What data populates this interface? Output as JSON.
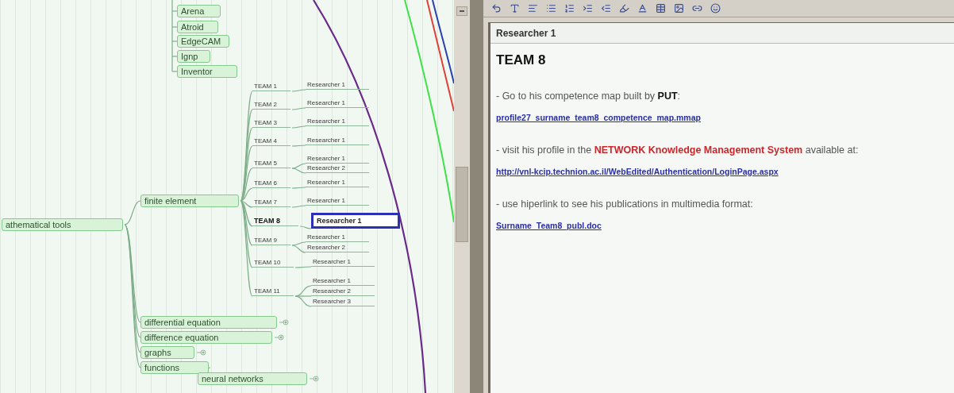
{
  "mind_map": {
    "nodes": [
      {
        "text": "Arena",
        "kind": "bubble",
        "selected": false
      },
      {
        "text": "Atroid",
        "kind": "bubble",
        "selected": false
      },
      {
        "text": "EdgeCAM",
        "kind": "bubble",
        "selected": false
      },
      {
        "text": "Ignp",
        "kind": "bubble",
        "selected": false
      },
      {
        "text": "Inventor",
        "kind": "bubble",
        "selected": false
      },
      {
        "text": "athematical tools",
        "kind": "bubble",
        "selected": false,
        "children": [
          {
            "text": "finite element",
            "kind": "bubble",
            "selected": false,
            "children": [
              {
                "text": "TEAM 1",
                "kind": "fork",
                "selected": false,
                "children": [
                  {
                    "text": "Researcher 1",
                    "kind": "fork",
                    "selected": false
                  }
                ]
              },
              {
                "text": "TEAM 2",
                "kind": "fork",
                "selected": false,
                "children": [
                  {
                    "text": "Researcher 1",
                    "kind": "fork",
                    "selected": false
                  }
                ]
              },
              {
                "text": "TEAM 3",
                "kind": "fork",
                "selected": false,
                "children": [
                  {
                    "text": "Researcher 1",
                    "kind": "fork",
                    "selected": false
                  }
                ]
              },
              {
                "text": "TEAM 4",
                "kind": "fork",
                "selected": false,
                "children": [
                  {
                    "text": "Researcher 1",
                    "kind": "fork",
                    "selected": false
                  }
                ]
              },
              {
                "text": "TEAM 5",
                "kind": "fork",
                "selected": false,
                "children": [
                  {
                    "text": "Researcher 1",
                    "kind": "fork",
                    "selected": false
                  },
                  {
                    "text": "Researcher 2",
                    "kind": "fork",
                    "selected": false
                  }
                ]
              },
              {
                "text": "TEAM 6",
                "kind": "fork",
                "selected": false,
                "children": [
                  {
                    "text": "Researcher 1",
                    "kind": "fork",
                    "selected": false
                  }
                ]
              },
              {
                "text": "TEAM 7",
                "kind": "fork",
                "selected": false,
                "children": [
                  {
                    "text": "Researcher 1",
                    "kind": "fork",
                    "selected": false
                  }
                ]
              },
              {
                "text": "TEAM 8",
                "kind": "fork",
                "bold": true,
                "selected": false,
                "children": [
                  {
                    "text": "Researcher 1",
                    "kind": "fork",
                    "selected": true
                  }
                ]
              },
              {
                "text": "TEAM 9",
                "kind": "fork",
                "selected": false,
                "children": [
                  {
                    "text": "Researcher 1",
                    "kind": "fork",
                    "selected": false
                  },
                  {
                    "text": "Researcher 2",
                    "kind": "fork",
                    "selected": false
                  }
                ]
              },
              {
                "text": "TEAM 10",
                "kind": "fork",
                "selected": false,
                "children": [
                  {
                    "text": "Researcher 1",
                    "kind": "fork",
                    "selected": false
                  }
                ]
              },
              {
                "text": "TEAM 11",
                "kind": "fork",
                "selected": false,
                "children": [
                  {
                    "text": "Researcher 1",
                    "kind": "fork",
                    "selected": false
                  },
                  {
                    "text": "Researcher 2",
                    "kind": "fork",
                    "selected": false
                  },
                  {
                    "text": "Researcher 3",
                    "kind": "fork",
                    "selected": false
                  }
                ]
              }
            ]
          },
          {
            "text": "differential equation",
            "kind": "bubble",
            "selected": false,
            "folded": true
          },
          {
            "text": "difference equation",
            "kind": "bubble",
            "selected": false,
            "folded": true
          },
          {
            "text": "graphs",
            "kind": "bubble",
            "selected": false,
            "folded": true
          },
          {
            "text": "functions",
            "kind": "bubble",
            "selected": false,
            "children": [
              {
                "text": "neural networks",
                "kind": "bubble",
                "selected": false,
                "folded": true
              }
            ]
          }
        ]
      }
    ]
  },
  "note_editor": {
    "title": "Researcher 1",
    "heading": "TEAM 8",
    "blocks": [
      {
        "kind": "paragraph",
        "parts": [
          {
            "text": "- Go to his competence map built by ",
            "kind": "plain"
          },
          {
            "text": "PUT",
            "kind": "strong"
          },
          {
            "text": ":",
            "kind": "plain"
          }
        ]
      },
      {
        "kind": "link",
        "text": "profile27_surname_team8_competence_map.mmap"
      },
      {
        "kind": "paragraph",
        "parts": [
          {
            "text": "- visit his profile in the ",
            "kind": "plain"
          },
          {
            "text": "NETWORK Knowledge Management System",
            "kind": "highlight"
          },
          {
            "text": " available at:",
            "kind": "plain"
          }
        ]
      },
      {
        "kind": "link",
        "text": "http://vnl-kcip.technion.ac.il/WebEdited/Authentication/LoginPage.aspx"
      },
      {
        "kind": "paragraph",
        "parts": [
          {
            "text": "- use hiperlink to see his publications in multimedia format:",
            "kind": "plain"
          }
        ]
      },
      {
        "kind": "link",
        "text": "Surname_Team8_publ.doc"
      }
    ]
  }
}
